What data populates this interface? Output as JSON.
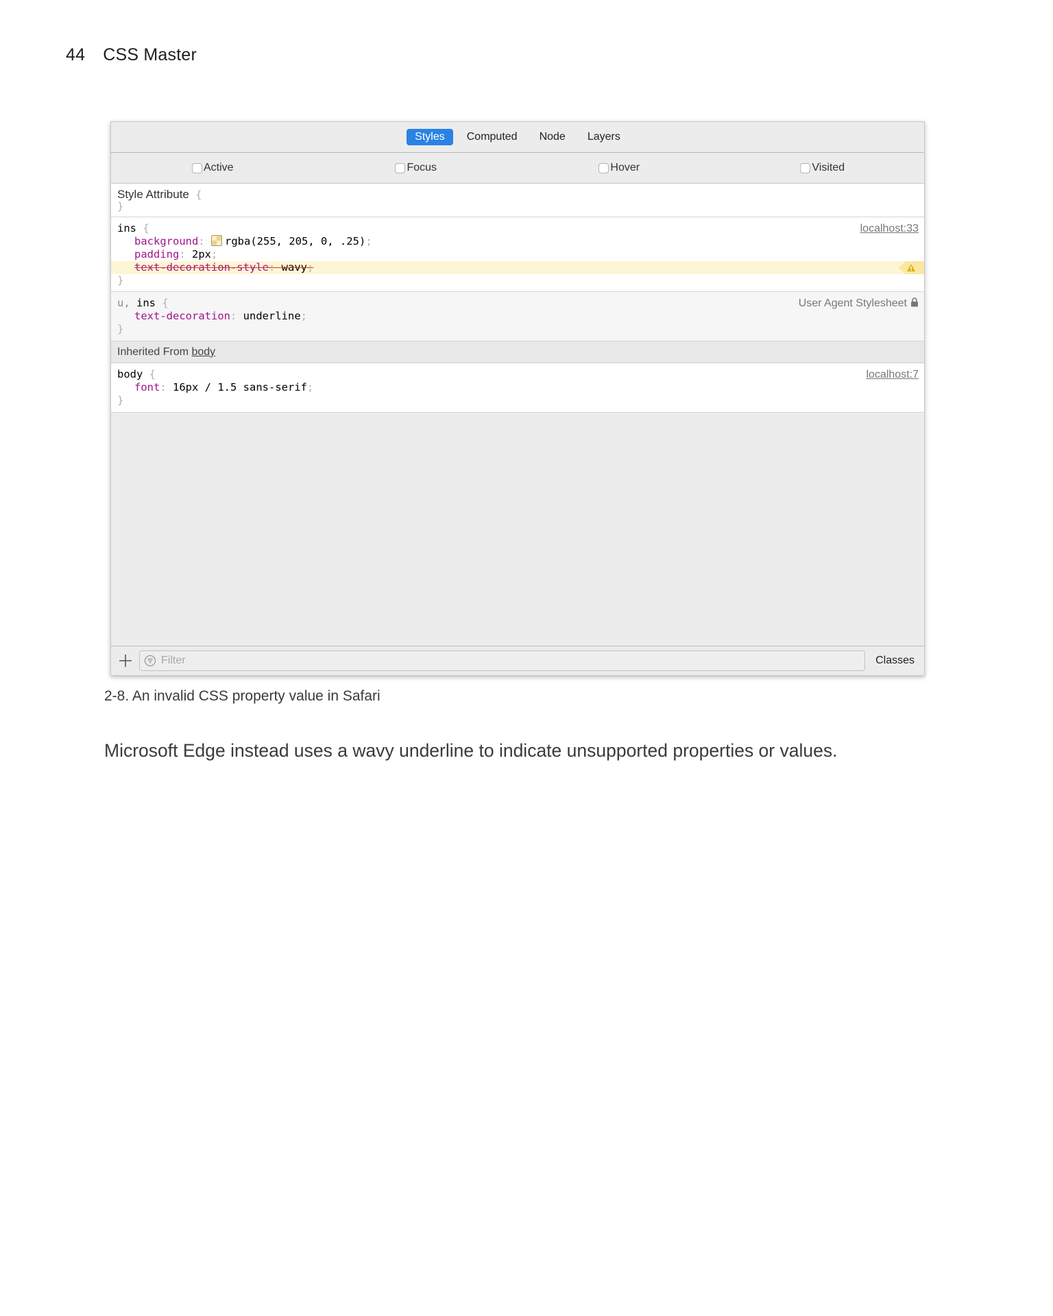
{
  "page_header": {
    "page_number": "44",
    "book_title": "CSS Master"
  },
  "devtools": {
    "tabs": [
      {
        "label": "Styles",
        "active": true
      },
      {
        "label": "Computed",
        "active": false
      },
      {
        "label": "Node",
        "active": false
      },
      {
        "label": "Layers",
        "active": false
      }
    ],
    "pseudo_states": [
      {
        "label": "Active",
        "checked": false
      },
      {
        "label": "Focus",
        "checked": false
      },
      {
        "label": "Hover",
        "checked": false
      },
      {
        "label": "Visited",
        "checked": false
      }
    ],
    "style_attribute": {
      "title": "Style Attribute",
      "open_brace": "{",
      "close_brace": "}"
    },
    "rules": [
      {
        "selector": "ins",
        "source": "localhost:33",
        "declarations": [
          {
            "property": "background",
            "value": "rgba(255, 205, 0, .25)",
            "swatch_color": "#ffcd00",
            "invalid": false
          },
          {
            "property": "padding",
            "value": "2px",
            "invalid": false
          },
          {
            "property": "text-decoration-style",
            "value": "wavy",
            "invalid": true
          }
        ]
      },
      {
        "selector_dim": "u,",
        "selector": "ins",
        "source": "User Agent Stylesheet",
        "declarations": [
          {
            "property": "text-decoration",
            "value": "underline",
            "invalid": false
          }
        ]
      }
    ],
    "inherited": {
      "prefix": "Inherited From ",
      "element": "body"
    },
    "inherited_rule": {
      "selector": "body",
      "source": "localhost:7",
      "declarations": [
        {
          "property": "font",
          "value": "16px / 1.5 sans-serif",
          "invalid": false
        }
      ]
    },
    "punct": {
      "open": "{",
      "close": "}",
      "colon": ":",
      "semicolon": ";"
    },
    "footer": {
      "add_label": "+",
      "filter_placeholder": "Filter",
      "filter_value": "",
      "classes_label": "Classes"
    }
  },
  "colors": {
    "accent": "#2a82e4",
    "property": "#a0148c",
    "warning_bg": "#fdf6d5",
    "warning_icon": "#e0b000"
  },
  "caption": "2-8. An invalid CSS property value in Safari",
  "body_text": "Microsoft Edge instead uses a wavy underline to indicate unsupported properties or values."
}
